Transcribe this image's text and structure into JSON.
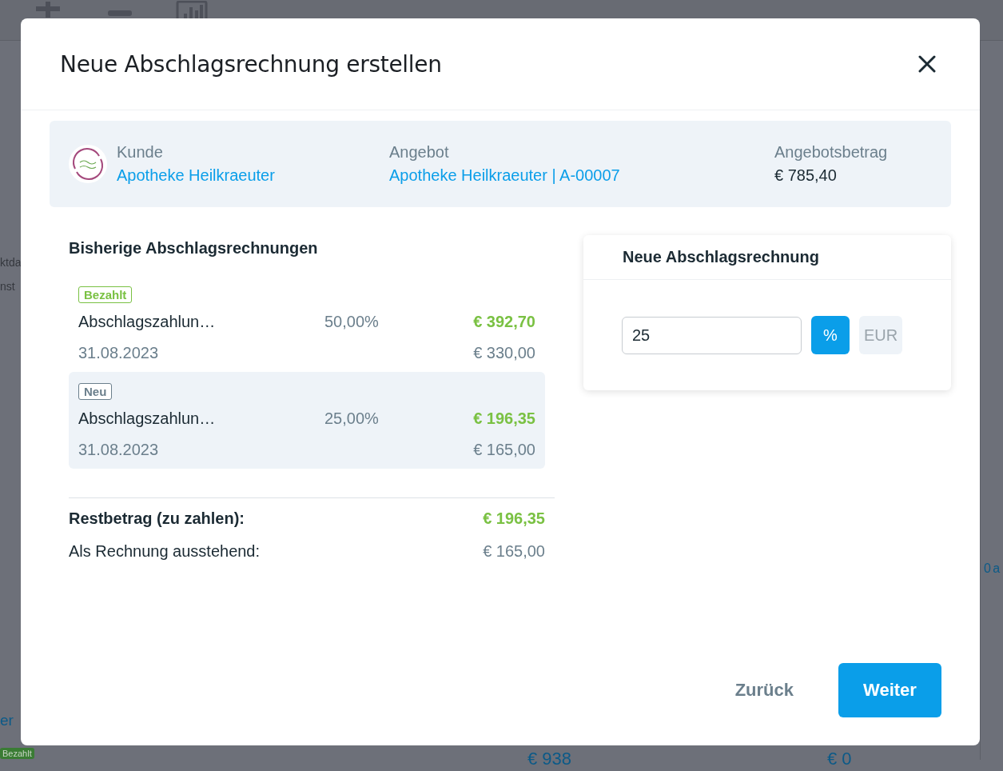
{
  "background": {
    "side_fragments": [
      "ktda",
      "nst"
    ],
    "link_fragment": "er",
    "badge": "Bezahlt",
    "right_fragment": "0 a",
    "amounts": [
      "€ 938",
      "€ 0"
    ]
  },
  "modal": {
    "title": "Neue Abschlagsrechnung erstellen",
    "info": [
      {
        "label": "Kunde",
        "value": "Apotheke Heilkraeuter",
        "kind": "link"
      },
      {
        "label": "Angebot",
        "value": "Apotheke Heilkraeuter | A-00007",
        "kind": "link"
      },
      {
        "label": "Angebotsbetrag",
        "value": "€ 785,40",
        "kind": "plain"
      }
    ],
    "previous": {
      "heading": "Bisherige Abschlagsrechnungen",
      "items": [
        {
          "status": "Bezahlt",
          "kind": "paid",
          "highlighted": false,
          "name": "Abschlagszahlun…",
          "percent": "50,00%",
          "amount": "€ 392,70",
          "date": "31.08.2023",
          "net": "€ 330,00"
        },
        {
          "status": "Neu",
          "kind": "new",
          "highlighted": true,
          "name": "Abschlagszahlun…",
          "percent": "25,00%",
          "amount": "€ 196,35",
          "date": "31.08.2023",
          "net": "€ 165,00"
        }
      ]
    },
    "summary": [
      {
        "label": "Restbetrag (zu zahlen):",
        "value": "€ 196,35",
        "emphasis": true
      },
      {
        "label": "Als Rechnung ausstehend:",
        "value": "€ 165,00",
        "emphasis": false
      }
    ],
    "new_invoice": {
      "title": "Neue Abschlagsrechnung",
      "value": "25",
      "units": [
        {
          "label": "%",
          "selected": true
        },
        {
          "label": "EUR",
          "selected": false
        }
      ]
    },
    "buttons": {
      "back": "Zurück",
      "next": "Weiter"
    }
  }
}
